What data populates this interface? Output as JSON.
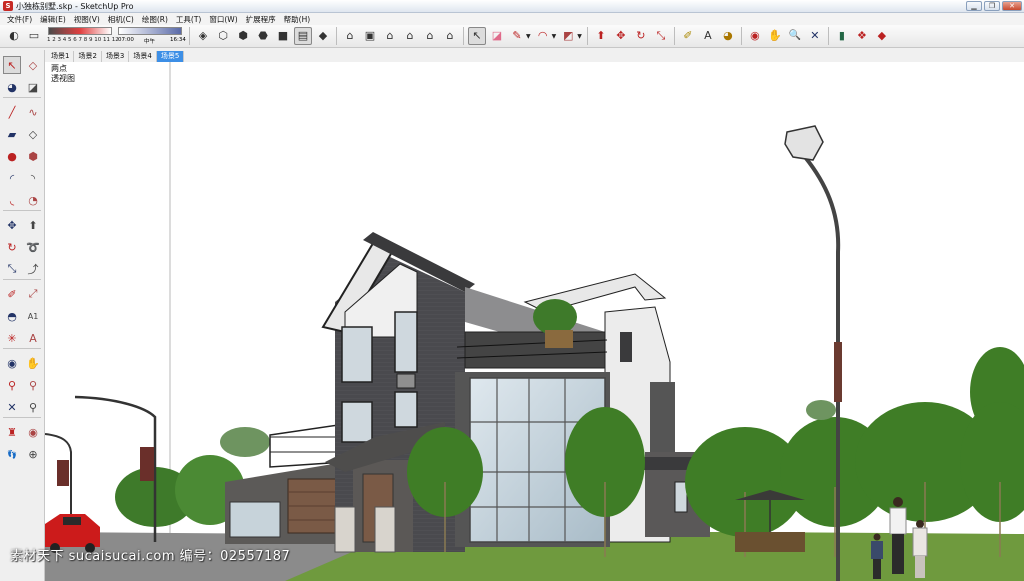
{
  "window": {
    "title": "小独栋别墅.skp - SketchUp Pro",
    "app_icon_glyph": "S",
    "buttons": [
      "minimize",
      "maximize",
      "close"
    ],
    "button_glyphs": {
      "minimize": "▁",
      "maximize": "❐",
      "close": "✕"
    }
  },
  "menu": [
    "文件(F)",
    "编辑(E)",
    "视图(V)",
    "相机(C)",
    "绘图(R)",
    "工具(T)",
    "窗口(W)",
    "扩展程序",
    "帮助(H)"
  ],
  "shadow_settings": {
    "months_label": "1 2 3 4 5 6 7 8 9 10 11 12",
    "time_start": "07:00",
    "time_noon": "中午",
    "time_end": "16:34"
  },
  "toolbar_icons": [
    {
      "name": "shadow-toggle-icon",
      "glyph": "◐"
    },
    {
      "name": "fog-icon",
      "glyph": "▭"
    },
    {
      "name": "xray-icon",
      "glyph": "◈"
    },
    {
      "name": "back-edges-icon",
      "glyph": "⬡"
    },
    {
      "name": "wireframe-icon",
      "glyph": "⬢"
    },
    {
      "name": "hidden-line-icon",
      "glyph": "⬣"
    },
    {
      "name": "shaded-icon",
      "glyph": "■"
    },
    {
      "name": "shaded-textures-icon",
      "glyph": "▤"
    },
    {
      "name": "monochrome-icon",
      "glyph": "◆"
    },
    {
      "name": "iso-view-icon",
      "glyph": "⌂"
    },
    {
      "name": "top-view-icon",
      "glyph": "▣"
    },
    {
      "name": "front-view-icon",
      "glyph": "⌂"
    },
    {
      "name": "right-view-icon",
      "glyph": "⌂"
    },
    {
      "name": "back-view-icon",
      "glyph": "⌂"
    },
    {
      "name": "left-view-icon",
      "glyph": "⌂"
    },
    {
      "name": "select-icon",
      "glyph": "↖"
    },
    {
      "name": "eraser-icon",
      "glyph": "◪"
    },
    {
      "name": "pencil-icon",
      "glyph": "✎"
    },
    {
      "name": "arc-icon",
      "glyph": "◠"
    },
    {
      "name": "rectangle-icon",
      "glyph": "◩"
    },
    {
      "name": "push-pull-icon",
      "glyph": "⬆"
    },
    {
      "name": "move-icon",
      "glyph": "✥"
    },
    {
      "name": "rotate-icon",
      "glyph": "↻"
    },
    {
      "name": "scale-icon",
      "glyph": "⤡"
    },
    {
      "name": "tape-measure-icon",
      "glyph": "✐"
    },
    {
      "name": "text-icon",
      "glyph": "A"
    },
    {
      "name": "paint-bucket-icon",
      "glyph": "◕"
    },
    {
      "name": "orbit-icon",
      "glyph": "◉"
    },
    {
      "name": "pan-icon",
      "glyph": "✋"
    },
    {
      "name": "zoom-icon",
      "glyph": "🔍"
    },
    {
      "name": "zoom-extents-icon",
      "glyph": "✕"
    },
    {
      "name": "components-icon",
      "glyph": "▮"
    },
    {
      "name": "warehouse-icon",
      "glyph": "❖"
    },
    {
      "name": "extension-icon",
      "glyph": "◆"
    }
  ],
  "left_tools": [
    {
      "name": "select-icon",
      "glyph": "↖"
    },
    {
      "name": "make-component-icon",
      "glyph": "◇"
    },
    {
      "name": "paint-bucket-icon",
      "glyph": "◕"
    },
    {
      "name": "eraser-icon",
      "glyph": "◪"
    },
    {
      "name": "line-icon",
      "glyph": "╱"
    },
    {
      "name": "freehand-icon",
      "glyph": "∿"
    },
    {
      "name": "rectangle-icon",
      "glyph": "▰"
    },
    {
      "name": "rotated-rectangle-icon",
      "glyph": "◇"
    },
    {
      "name": "circle-icon",
      "glyph": "●"
    },
    {
      "name": "polygon-icon",
      "glyph": "⬢"
    },
    {
      "name": "arc-icon",
      "glyph": "◜"
    },
    {
      "name": "two-point-arc-icon",
      "glyph": "◝"
    },
    {
      "name": "three-point-arc-icon",
      "glyph": "◟"
    },
    {
      "name": "pie-icon",
      "glyph": "◔"
    },
    {
      "name": "move-icon",
      "glyph": "✥"
    },
    {
      "name": "push-pull-icon",
      "glyph": "⬆"
    },
    {
      "name": "rotate-icon",
      "glyph": "↻"
    },
    {
      "name": "follow-me-icon",
      "glyph": "➰"
    },
    {
      "name": "scale-icon",
      "glyph": "⤡"
    },
    {
      "name": "offset-icon",
      "glyph": "⤴"
    },
    {
      "name": "tape-measure-icon",
      "glyph": "✐"
    },
    {
      "name": "dimension-icon",
      "glyph": "⤢"
    },
    {
      "name": "protractor-icon",
      "glyph": "◓"
    },
    {
      "name": "text-icon",
      "glyph": "A1"
    },
    {
      "name": "axes-icon",
      "glyph": "✳"
    },
    {
      "name": "3d-text-icon",
      "glyph": "A"
    },
    {
      "name": "orbit-icon",
      "glyph": "◉"
    },
    {
      "name": "pan-icon",
      "glyph": "✋"
    },
    {
      "name": "zoom-icon",
      "glyph": "⚲"
    },
    {
      "name": "zoom-window-icon",
      "glyph": "⚲"
    },
    {
      "name": "zoom-extents-icon",
      "glyph": "✕"
    },
    {
      "name": "previous-view-icon",
      "glyph": "⚲"
    },
    {
      "name": "position-camera-icon",
      "glyph": "♜"
    },
    {
      "name": "look-around-icon",
      "glyph": "◉"
    },
    {
      "name": "walk-icon",
      "glyph": "👣"
    },
    {
      "name": "section-plane-icon",
      "glyph": "⊕"
    }
  ],
  "scene_tabs": [
    "场景1",
    "场景2",
    "场景3",
    "场景4",
    "场景5"
  ],
  "selected_tab": "场景5",
  "scene_info": {
    "line1": "两点",
    "line2": "透视图"
  },
  "watermark": "素材天下 sucaisucai.com  编号：02557187",
  "colors": {
    "selected_tab": "#3d8fe6",
    "building_dark": "#3f3f42",
    "foliage": "#3e7a2a",
    "car_red": "#cc1b1b"
  }
}
